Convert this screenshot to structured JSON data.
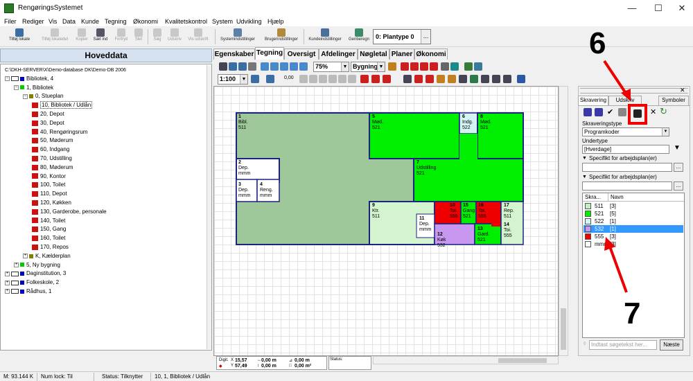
{
  "window": {
    "title": "RengøringsSystemet",
    "minimize": "—",
    "maximize": "☐",
    "close": "✕"
  },
  "menu": [
    "Filer",
    "Rediger",
    "Vis",
    "Data",
    "Kunde",
    "Tegning",
    "Økonomi",
    "Kvalitetskontrol",
    "System",
    "Udvikling",
    "Hjælp"
  ],
  "toolbar": {
    "buttons": [
      {
        "label": "Tilføj lokale",
        "enabled": true
      },
      {
        "label": "Tilføj lokaledel",
        "enabled": false
      },
      {
        "label": "Kopier",
        "enabled": false
      },
      {
        "label": "Sæt ind",
        "enabled": true
      },
      {
        "label": "Fortryd",
        "enabled": false
      },
      {
        "label": "Slet",
        "enabled": false
      },
      {
        "label": "Søg",
        "enabled": false
      },
      {
        "label": "Udskriv",
        "enabled": false
      },
      {
        "label": "Vis udskrift",
        "enabled": false
      },
      {
        "label": "Systemindstillinger",
        "enabled": true
      },
      {
        "label": "Brugerindstillinger",
        "enabled": true
      },
      {
        "label": "Kundeindstillinger",
        "enabled": true
      },
      {
        "label": "Genberegn",
        "enabled": true
      }
    ],
    "plantype": "0: Plantype 0",
    "plantype_dots": "..."
  },
  "left": {
    "header": "Hoveddata",
    "tree": [
      {
        "label": "C:\\DKH-SERVER\\X\\Demo-database DK\\Demo-DB 2006",
        "level": 0,
        "icon": "none",
        "exp": ""
      },
      {
        "label": "Bibliotek, 4",
        "level": 0,
        "icon": "building",
        "color": "#0000cc",
        "exp": "−"
      },
      {
        "label": "1, Bibliotek",
        "level": 1,
        "icon": "square",
        "color": "#00cc00",
        "exp": "−"
      },
      {
        "label": "0, Stueplan",
        "level": 2,
        "icon": "square",
        "color": "#808000",
        "exp": "−"
      },
      {
        "label": "10, Bibliotek / Udlån",
        "level": 3,
        "icon": "doc",
        "exp": "",
        "selected": true
      },
      {
        "label": "20, Depot",
        "level": 3,
        "icon": "doc",
        "exp": ""
      },
      {
        "label": "30, Depot",
        "level": 3,
        "icon": "doc",
        "exp": ""
      },
      {
        "label": "40, Rengøringsrum",
        "level": 3,
        "icon": "doc",
        "exp": ""
      },
      {
        "label": "50, Møderum",
        "level": 3,
        "icon": "doc",
        "exp": ""
      },
      {
        "label": "60, Indgang",
        "level": 3,
        "icon": "doc",
        "exp": ""
      },
      {
        "label": "70, Udstilling",
        "level": 3,
        "icon": "doc",
        "exp": ""
      },
      {
        "label": "80, Møderum",
        "level": 3,
        "icon": "doc",
        "exp": ""
      },
      {
        "label": "90, Kontor",
        "level": 3,
        "icon": "doc",
        "exp": ""
      },
      {
        "label": "100, Toilet",
        "level": 3,
        "icon": "doc",
        "exp": ""
      },
      {
        "label": "110, Depot",
        "level": 3,
        "icon": "doc",
        "exp": ""
      },
      {
        "label": "120, Køkken",
        "level": 3,
        "icon": "doc",
        "exp": ""
      },
      {
        "label": "130, Garderobe, personale",
        "level": 3,
        "icon": "doc",
        "exp": ""
      },
      {
        "label": "140, Toilet",
        "level": 3,
        "icon": "doc",
        "exp": ""
      },
      {
        "label": "150, Gang",
        "level": 3,
        "icon": "doc",
        "exp": ""
      },
      {
        "label": "160, Toilet",
        "level": 3,
        "icon": "doc",
        "exp": ""
      },
      {
        "label": "170, Repos",
        "level": 3,
        "icon": "doc",
        "exp": ""
      },
      {
        "label": "K, Kælderplan",
        "level": 2,
        "icon": "square",
        "color": "#808000",
        "exp": "+"
      },
      {
        "label": "5, Ny bygning",
        "level": 1,
        "icon": "square",
        "color": "#00cc00",
        "exp": "+"
      },
      {
        "label": "Daginstitution, 3",
        "level": 0,
        "icon": "building",
        "color": "#0000cc",
        "exp": "+"
      },
      {
        "label": "Folkeskole, 2",
        "level": 0,
        "icon": "building",
        "color": "#0000cc",
        "exp": "+"
      },
      {
        "label": "Rådhus, 1",
        "level": 0,
        "icon": "building",
        "color": "#0000cc",
        "exp": "+"
      }
    ]
  },
  "tabs": [
    "Egenskaber",
    "Tegning",
    "Oversigt",
    "Afdelinger",
    "Nøgletal",
    "Planer",
    "Økonomi"
  ],
  "active_tab": "Tegning",
  "drawing": {
    "zoom": "75%",
    "layer": "Bygning",
    "scale": "1:100",
    "small_value": "0,00"
  },
  "rooms": [
    {
      "num": "1",
      "name": "Bibl.",
      "code": "511"
    },
    {
      "num": "2",
      "name": "Dep.",
      "code": "mmm"
    },
    {
      "num": "3",
      "name": "Dep.",
      "code": "mmm"
    },
    {
      "num": "4",
      "name": "Reng.",
      "code": "mmm"
    },
    {
      "num": "5",
      "name": "Mød.",
      "code": "521"
    },
    {
      "num": "6",
      "name": "Indg.",
      "code": "522"
    },
    {
      "num": "8",
      "name": "Mød.",
      "code": "521"
    },
    {
      "num": "7",
      "name": "Udstilling",
      "code": "521"
    },
    {
      "num": "9",
      "name": "Ktr.",
      "code": "511"
    },
    {
      "num": "11",
      "name": "Dep.",
      "code": "mmm"
    },
    {
      "num": "12",
      "name": "Køk",
      "code": "532"
    },
    {
      "num": "10",
      "name": "Toi.",
      "code": "555"
    },
    {
      "num": "15",
      "name": "Gang",
      "code": "521"
    },
    {
      "num": "16",
      "name": "Toi.",
      "code": "555"
    },
    {
      "num": "17",
      "name": "Rep.",
      "code": "511"
    },
    {
      "num": "13",
      "name": "Gard.",
      "code": "521"
    },
    {
      "num": "14",
      "name": "Toi.",
      "code": "555"
    }
  ],
  "coords": {
    "digit_label": "Digit.",
    "x": "15,57",
    "y": "57,49",
    "dx": "0,00 m",
    "dy": "0,00 m",
    "area": "0,00 m",
    "area2": "0,00 m²",
    "status_label": "Status:"
  },
  "right": {
    "tabs": [
      "Skravering",
      "Udskriv",
      "Symboler"
    ],
    "type_label": "Skraveringstype",
    "type_value": "Programkoder",
    "subtype_label": "Undertype",
    "subtype_value": "[Hverdage]",
    "specific1": "Specifikt for arbejdsplan(er)",
    "specific2": "Specifikt for arbejdsplan(er)",
    "col_code": "Skra...",
    "col_name": "Navn",
    "legend": [
      {
        "code": "511",
        "name": "[3]",
        "color": "#c0f0c0",
        "selected": false
      },
      {
        "code": "521",
        "name": "[5]",
        "color": "#00ee00",
        "selected": false
      },
      {
        "code": "522",
        "name": "[1]",
        "color": "#d4f4f4",
        "selected": false
      },
      {
        "code": "532",
        "name": "[1]",
        "color": "#c898f0",
        "selected": true
      },
      {
        "code": "555",
        "name": "[3]",
        "color": "#ee0000",
        "selected": false
      },
      {
        "code": "mmm",
        "name": "[3]",
        "color": "#ffffff",
        "selected": false
      }
    ],
    "search_placeholder": "Indtast søgetekst her...",
    "next_button": "Næste"
  },
  "status": {
    "memory": "M: 93.144 K",
    "numlock": "Num lock: Til",
    "status": "Status: Tilknytter",
    "selection": "10, 1, Bibliotek / Udlån"
  },
  "annotations": {
    "step6": "6",
    "step7": "7",
    "color": "#ee0000"
  }
}
